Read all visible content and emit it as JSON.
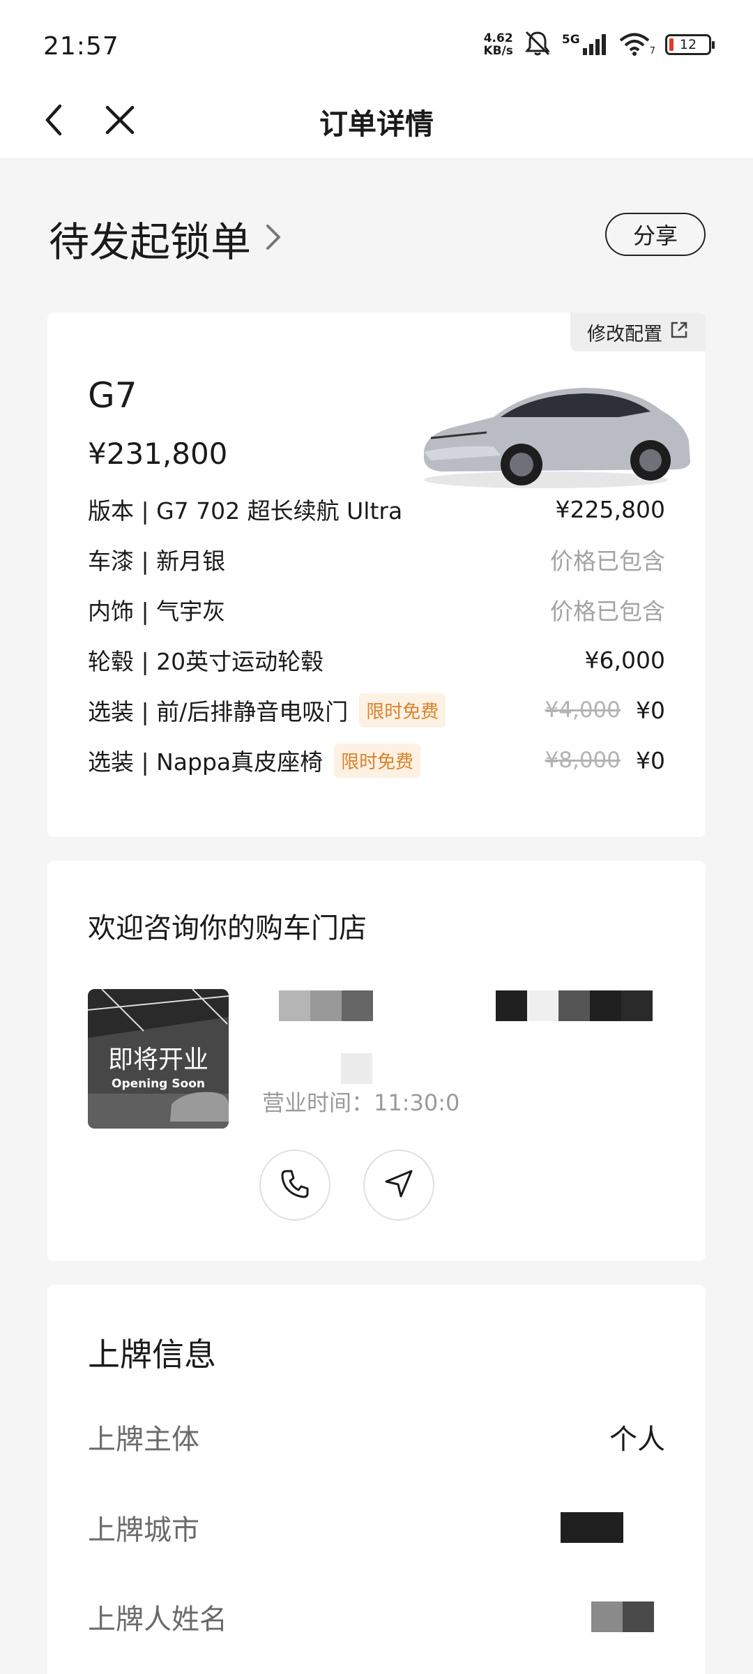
{
  "status_bar": {
    "time": "21:57",
    "net_speed_value": "4.62",
    "net_speed_unit": "KB/s",
    "signal_label": "5G",
    "wifi_sub": "7",
    "battery_level": "12"
  },
  "nav": {
    "title": "订单详情",
    "back_icon": "chevron-left-icon",
    "close_icon": "close-icon"
  },
  "order": {
    "status_text": "待发起锁单",
    "share_label": "分享"
  },
  "car": {
    "modify_label": "修改配置",
    "model": "G7",
    "price": "¥231,800",
    "specs": [
      {
        "label": "版本 | G7 702 超长续航 Ultra",
        "value": "¥225,800"
      },
      {
        "label": "车漆 | 新月银",
        "value": "价格已包含"
      },
      {
        "label": "内饰 | 气宇灰",
        "value": "价格已包含"
      },
      {
        "label": "轮毂 | 20英寸运动轮毂",
        "value": "¥6,000"
      },
      {
        "label": "选装 | 前/后排静音电吸门",
        "tag": "限时免费",
        "original": "¥4,000",
        "value": "¥0"
      },
      {
        "label": "选装 | Nappa真皮座椅",
        "tag": "限时免费",
        "original": "¥8,000",
        "value": "¥0"
      }
    ]
  },
  "store": {
    "title": "欢迎咨询你的购车门店",
    "image_text_cn": "即将开业",
    "image_text_en": "Opening Soon",
    "hours": "营业时间：11:30:0",
    "phone_icon": "phone-icon",
    "navigate_icon": "navigate-icon"
  },
  "plate": {
    "title": "上牌信息",
    "rows": [
      {
        "label": "上牌主体",
        "value": "个人"
      },
      {
        "label": "上牌城市",
        "value": ""
      },
      {
        "label": "上牌人姓名",
        "value": ""
      }
    ]
  },
  "colors": {
    "tag_bg": "#fdf1e3",
    "tag_text": "#d9822b",
    "muted": "#a3a3a3",
    "page_bg": "#f5f5f5"
  }
}
